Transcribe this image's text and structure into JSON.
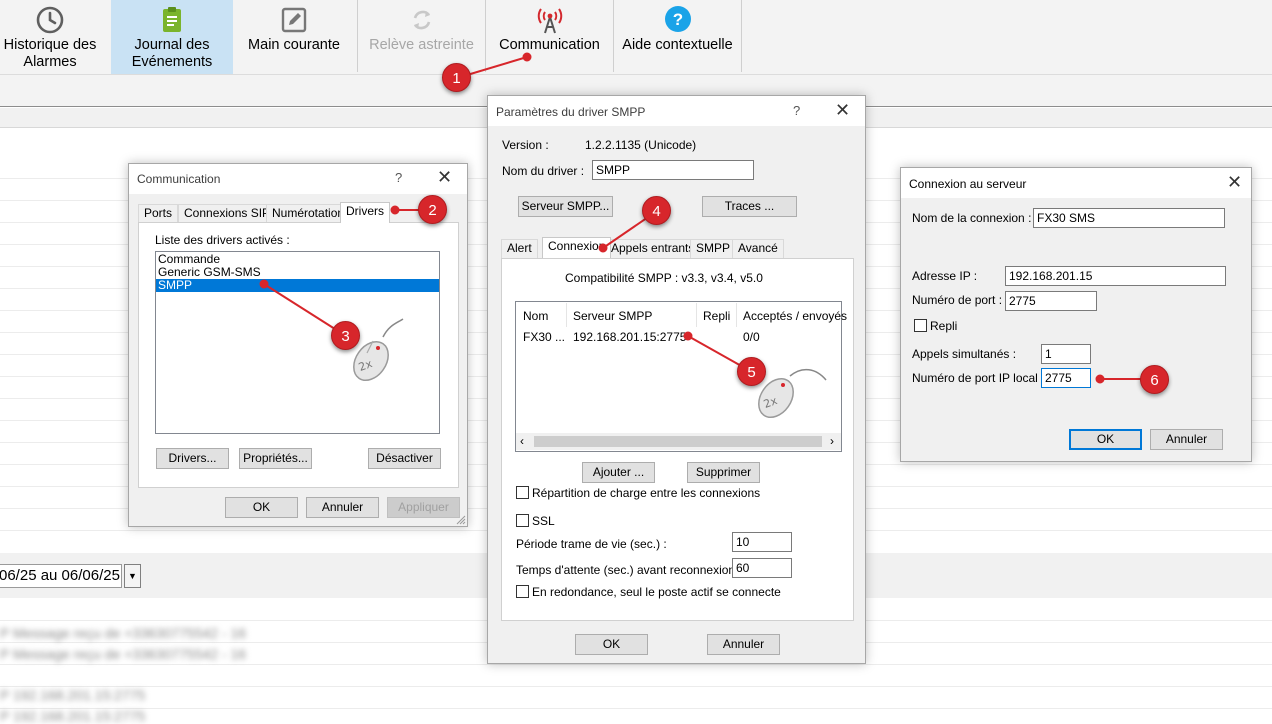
{
  "toolbar": {
    "items": [
      {
        "label": "Historique des Alarmes",
        "icon": "clock-icon"
      },
      {
        "label": "Journal des Evénements",
        "icon": "clipboard-icon"
      },
      {
        "label": "Main courante",
        "icon": "edit-icon"
      },
      {
        "label": "Relève astreinte",
        "icon": "refresh-icon"
      },
      {
        "label": "Communication",
        "icon": "antenna-icon"
      },
      {
        "label": "Aide contextuelle",
        "icon": "help-icon"
      }
    ]
  },
  "date_filter": {
    "value": "06/25 au 06/06/25"
  },
  "blurred_rows": [
    "P Message reçu de +33630775542 - 16",
    "P Message reçu de +33630775542 - 16",
    "P 192.168.201.15:2775",
    "P 192.168.201.15:2775"
  ],
  "communication_dialog": {
    "title": "Communication",
    "title_help": "?",
    "tabs": [
      "Ports",
      "Connexions SIP",
      "Numérotation",
      "Drivers"
    ],
    "list_label": "Liste des drivers activés :",
    "drivers": [
      "Commande",
      "Generic GSM-SMS",
      "SMPP"
    ],
    "selected_driver": "SMPP",
    "btn_drivers": "Drivers...",
    "btn_properties": "Propriétés...",
    "btn_deactivate": "Désactiver",
    "btn_ok": "OK",
    "btn_cancel": "Annuler",
    "btn_apply": "Appliquer"
  },
  "smpp_dialog": {
    "title": "Paramètres du driver SMPP",
    "title_help": "?",
    "version_label": "Version :",
    "version_value": "1.2.2.1135 (Unicode)",
    "driver_name_label": "Nom du driver :",
    "driver_name_value": "SMPP",
    "btn_server": "Serveur SMPP...",
    "btn_traces": "Traces ...",
    "tabs": [
      "Alert",
      "Connexion",
      "Appels entrants",
      "SMPP",
      "Avancé"
    ],
    "compat": "Compatibilité SMPP : v3.3, v3.4, v5.0",
    "columns": [
      "Nom",
      "Serveur SMPP",
      "Repli",
      "Acceptés / envoyés"
    ],
    "rows": [
      {
        "nom": "FX30 ...",
        "serveur": "192.168.201.15:2775",
        "repli": "",
        "acceptes": "0/0"
      }
    ],
    "btn_add": "Ajouter ...",
    "btn_delete": "Supprimer",
    "load_balance_label": "Répartition de charge entre les connexions",
    "ssl_label": "SSL",
    "keepalive_label": "Période trame de vie (sec.) :",
    "keepalive_value": "10",
    "reconnect_label": "Temps d'attente (sec.) avant reconnexion :",
    "reconnect_value": "60",
    "redundancy_label": "En redondance, seul le poste actif se connecte",
    "btn_ok": "OK",
    "btn_cancel": "Annuler"
  },
  "server_dialog": {
    "title": "Connexion au serveur",
    "conn_name_label": "Nom de la connexion :",
    "conn_name_value": "FX30 SMS",
    "ip_label": "Adresse IP :",
    "ip_value": "192.168.201.15",
    "port_label": "Numéro de port :",
    "port_value": "2775",
    "fallback_label": "Repli",
    "calls_label": "Appels simultanés :",
    "calls_value": "1",
    "local_port_label": "Numéro de port IP local :",
    "local_port_value": "2775",
    "btn_ok": "OK",
    "btn_cancel": "Annuler"
  },
  "callouts": [
    "1",
    "2",
    "3",
    "4",
    "5",
    "6"
  ],
  "mouse_hint": "2x",
  "colors": {
    "accent": "#0078d7",
    "callout": "#d7262b",
    "active_toolbar": "#c9e2f4"
  }
}
